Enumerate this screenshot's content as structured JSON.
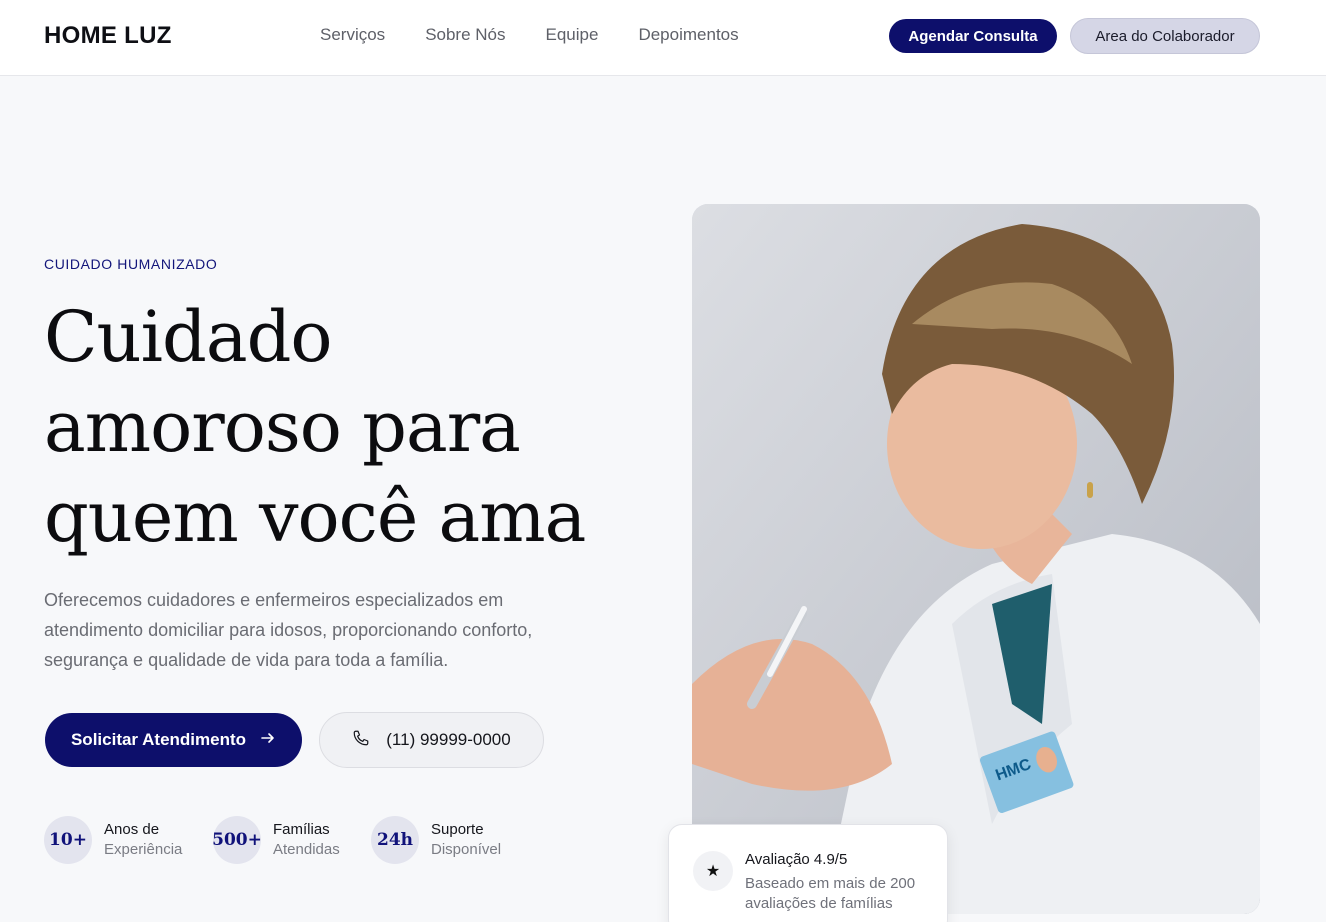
{
  "header": {
    "brand": "HOME LUZ",
    "nav": [
      "Serviços",
      "Sobre Nós",
      "Equipe",
      "Depoimentos"
    ],
    "schedule_label": "Agendar Consulta",
    "collab_label": "Area do Colaborador"
  },
  "hero": {
    "eyebrow": "CUIDADO HUMANIZADO",
    "headline": [
      "Cuidado",
      "amoroso para",
      "quem você ama"
    ],
    "lead": "Oferecemos cuidadores e enfermeiros especializados em atendimento domiciliar para idosos, proporcionando conforto, segurança e qualidade de vida para toda a família.",
    "primary_cta": "Solicitar Atendimento",
    "primary_cta_icon": "arrow-right-icon",
    "phone_icon": "phone-icon",
    "phone": "(11) 99999-0000",
    "stats": [
      {
        "value": "10+",
        "line1": "Anos de",
        "line2": "Experiência"
      },
      {
        "value": "500+",
        "line1": "Famílias",
        "line2": "Atendidas"
      },
      {
        "value": "24h",
        "line1": "Suporte",
        "line2": "Disponível"
      }
    ]
  },
  "photo": {
    "badge_text": "HMC",
    "description_icon": "nurse-photo"
  },
  "rating_card": {
    "icon": "star-icon",
    "title": "Avaliação 4.9/5",
    "subtitle": "Baseado em mais de 200 avaliações de famílias"
  },
  "colors": {
    "brand_navy": "#0d0f6b",
    "collab_bg": "#d5d6e6",
    "page_bg": "#f7f8fa"
  }
}
